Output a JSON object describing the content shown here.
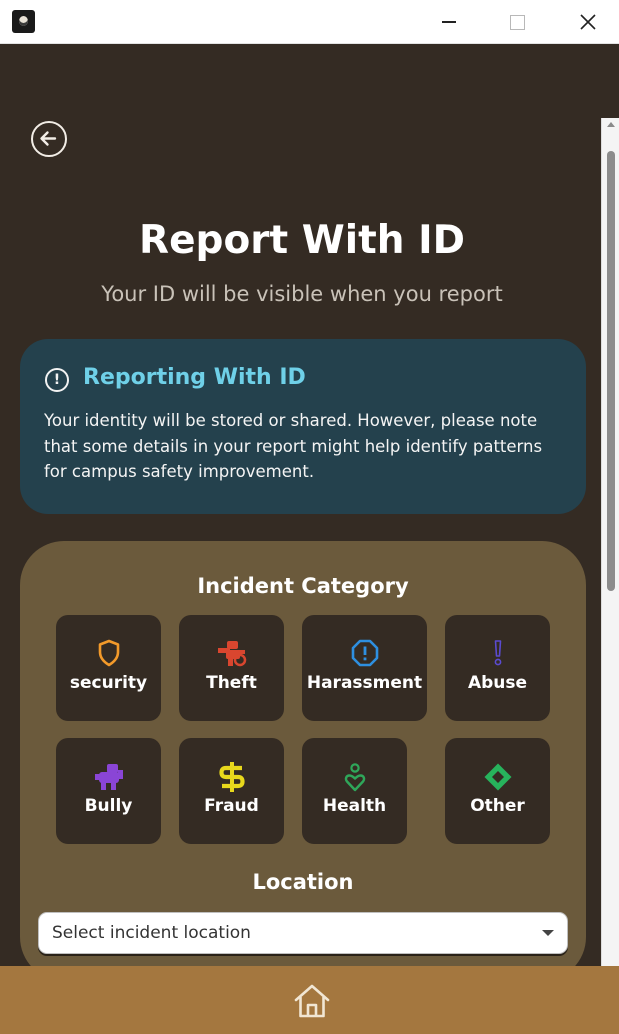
{
  "header": {
    "title": "Report With ID",
    "subtitle": "Your ID will be visible when you report"
  },
  "info_card": {
    "title": "Reporting With ID",
    "icon": "exclamation-circle-icon",
    "text": "Your identity will be stored or shared. However, please note that some details in your report might help identify patterns for campus safety improvement."
  },
  "incident_category": {
    "title": "Incident Category",
    "items": [
      {
        "label": "security",
        "icon": "shield-icon",
        "color": "#f39a2a"
      },
      {
        "label": "Theft",
        "icon": "thief-icon",
        "color": "#d9462f"
      },
      {
        "label": "Harassment",
        "icon": "warning-octagon-icon",
        "color": "#2e8fe0"
      },
      {
        "label": "Abuse",
        "icon": "exclamation-icon",
        "color": "#5b4bd1"
      },
      {
        "label": "Bully",
        "icon": "bully-icon",
        "color": "#8a45d6"
      },
      {
        "label": "Fraud",
        "icon": "dollar-icon",
        "color": "#e8d81c"
      },
      {
        "label": "Health",
        "icon": "health-icon",
        "color": "#2fa75a"
      },
      {
        "label": "Other",
        "icon": "diamond-icon",
        "color": "#27b35c"
      }
    ]
  },
  "location": {
    "title": "Location",
    "placeholder": "Select incident location"
  },
  "nav": {
    "home_icon": "home-icon"
  }
}
